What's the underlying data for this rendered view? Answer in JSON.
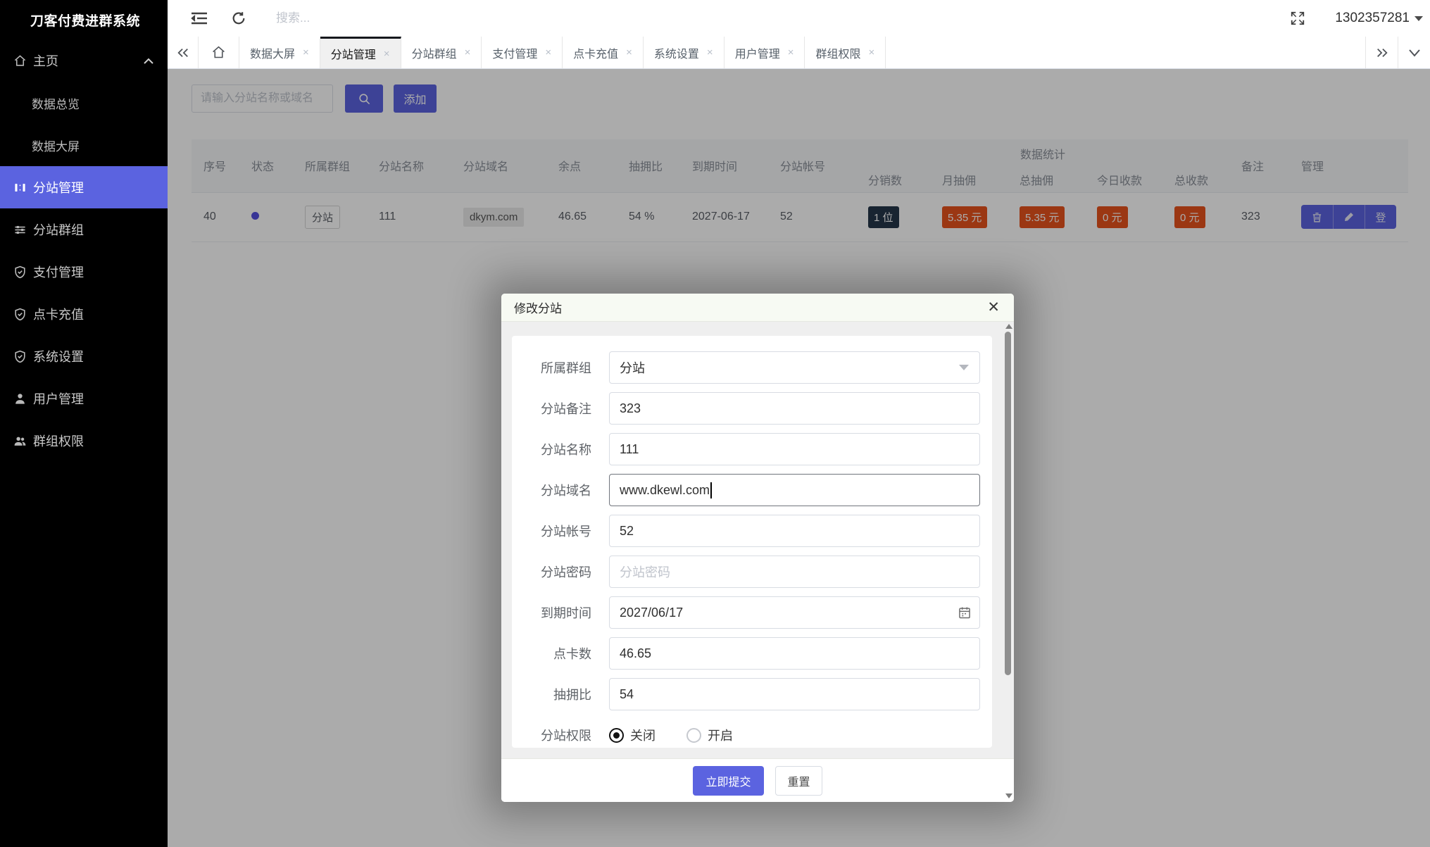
{
  "colors": {
    "brand": "#5b63e0",
    "badge_orange": "#e8521d",
    "badge_navy": "#24364a",
    "active_tab_top": "#16181d"
  },
  "sidebar": {
    "brand": "刀客付费进群系统",
    "items": [
      {
        "label": "主页",
        "icon": "home-icon",
        "expanded": true
      },
      {
        "label": "数据总览",
        "sub": true
      },
      {
        "label": "数据大屏",
        "sub": true
      },
      {
        "label": "分站管理",
        "icon": "site-manage-icon",
        "active": true
      },
      {
        "label": "分站群组",
        "icon": "sliders-icon"
      },
      {
        "label": "支付管理",
        "icon": "shield-icon"
      },
      {
        "label": "点卡充值",
        "icon": "shield-icon"
      },
      {
        "label": "系统设置",
        "icon": "shield-icon"
      },
      {
        "label": "用户管理",
        "icon": "user-icon"
      },
      {
        "label": "群组权限",
        "icon": "users-icon"
      }
    ]
  },
  "topbar": {
    "search_placeholder": "搜索...",
    "username": "1302357281"
  },
  "tabbar": {
    "tabs": [
      {
        "label": "数据大屏"
      },
      {
        "label": "分站管理",
        "active": true
      },
      {
        "label": "分站群组"
      },
      {
        "label": "支付管理"
      },
      {
        "label": "点卡充值"
      },
      {
        "label": "系统设置"
      },
      {
        "label": "用户管理"
      },
      {
        "label": "群组权限"
      }
    ],
    "close_glyph": "×"
  },
  "toolbar": {
    "search_placeholder": "请输入分站名称或域名",
    "add_label": "添加"
  },
  "table": {
    "group_header": "数据统计",
    "columns": [
      "序号",
      "状态",
      "所属群组",
      "分站名称",
      "分站域名",
      "余点",
      "抽拥比",
      "到期时间",
      "分站帐号",
      "分销数",
      "月抽佣",
      "总抽佣",
      "今日收款",
      "总收款",
      "备注",
      "管理"
    ],
    "row": {
      "seq": "40",
      "group_tag": "分站",
      "name": "111",
      "domain": "dkym.com",
      "balance": "46.65",
      "commission_rate": "54 %",
      "expire": "2027-06-17",
      "account": "52",
      "distributors": "1 位",
      "month_commission": "5.35 元",
      "total_commission": "5.35 元",
      "today_income": "0 元",
      "total_income": "0 元",
      "remark": "323",
      "login_label": "登"
    }
  },
  "modal": {
    "title": "修改分站",
    "fields": [
      {
        "label": "所属群组",
        "type": "select",
        "value": "分站"
      },
      {
        "label": "分站备注",
        "type": "text",
        "value": "323"
      },
      {
        "label": "分站名称",
        "type": "text",
        "value": "111"
      },
      {
        "label": "分站域名",
        "type": "text",
        "value": "www.dkewl.com",
        "focused": true
      },
      {
        "label": "分站帐号",
        "type": "text",
        "value": "52"
      },
      {
        "label": "分站密码",
        "type": "password",
        "placeholder": "分站密码"
      },
      {
        "label": "到期时间",
        "type": "date",
        "value": "2027/06/17"
      },
      {
        "label": "点卡数",
        "type": "text",
        "value": "46.65"
      },
      {
        "label": "抽拥比",
        "type": "text",
        "value": "54"
      }
    ],
    "permission": {
      "label": "分站权限",
      "options": [
        {
          "label": "关闭",
          "selected": true
        },
        {
          "label": "开启",
          "selected": false
        }
      ]
    },
    "submit_label": "立即提交",
    "reset_label": "重置"
  }
}
